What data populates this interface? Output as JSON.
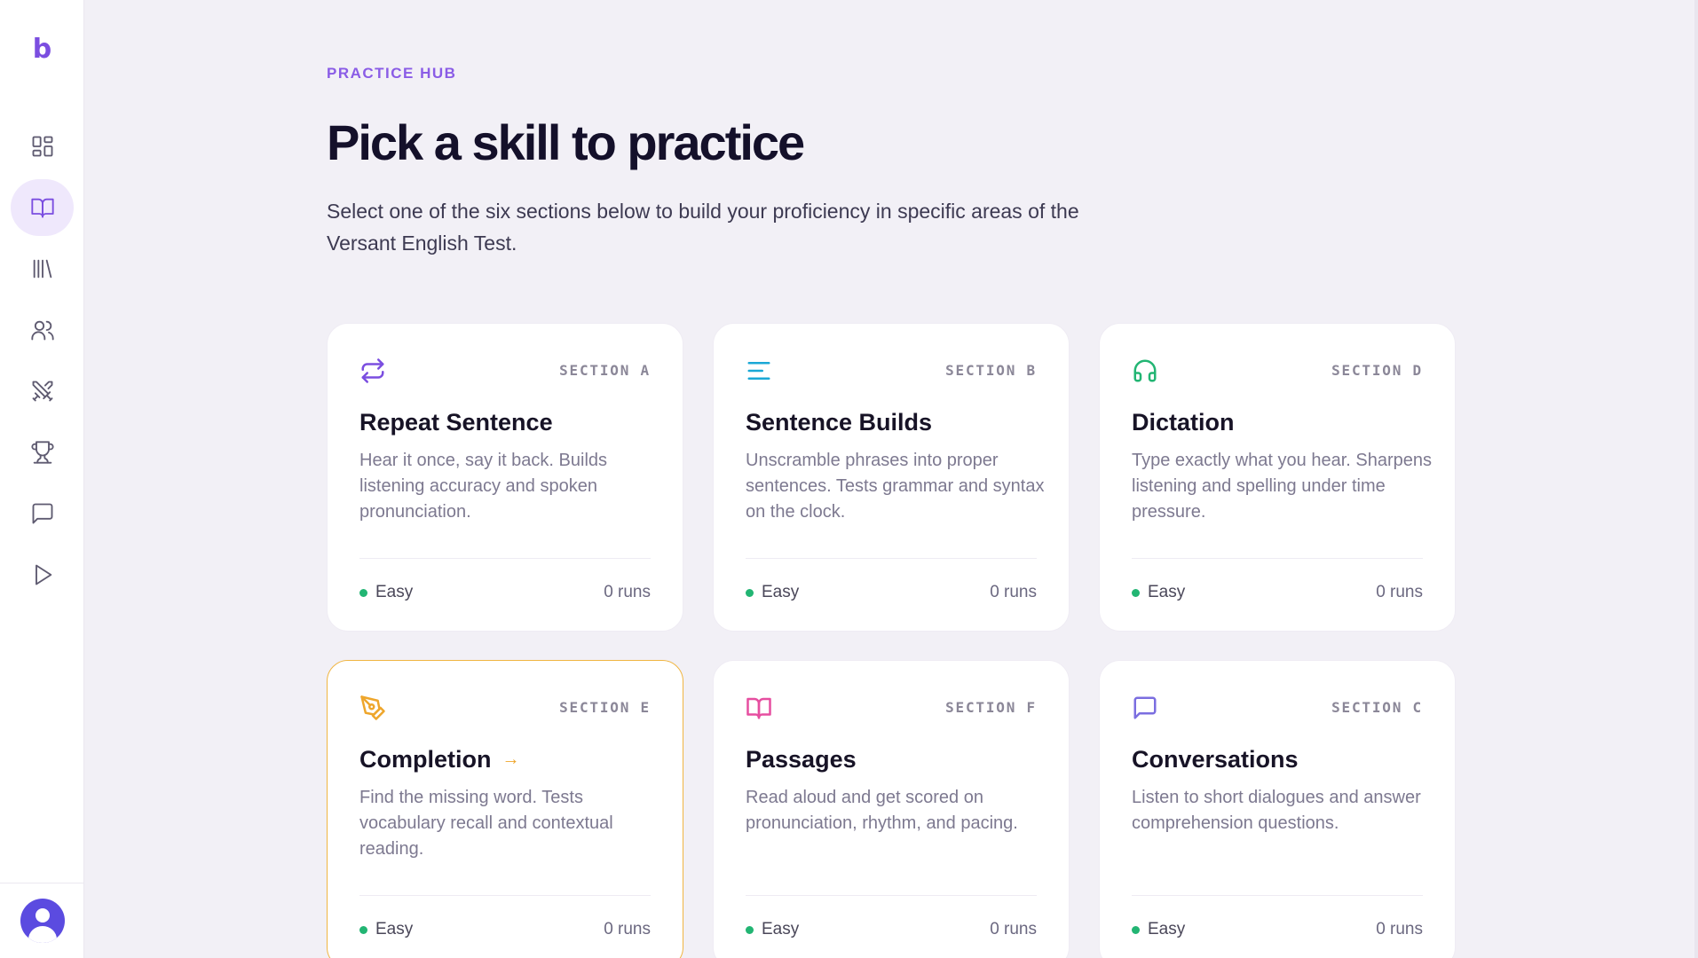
{
  "app": {
    "logo": "b"
  },
  "header": {
    "eyebrow": "PRACTICE HUB",
    "title": "Pick a skill to practice",
    "subtitle": "Select one of the six sections below to build your proficiency in specific areas of the Versant English Test."
  },
  "sidebar": {
    "items": [
      {
        "icon": "dashboard-icon"
      },
      {
        "icon": "open-book-icon",
        "active": true
      },
      {
        "icon": "library-icon"
      },
      {
        "icon": "users-icon"
      },
      {
        "icon": "swords-icon"
      },
      {
        "icon": "trophy-icon"
      },
      {
        "icon": "chat-icon"
      },
      {
        "icon": "play-icon"
      }
    ]
  },
  "cards": [
    {
      "section": "SECTION A",
      "name": "Repeat Sentence",
      "desc": "Hear it once, say it back. Builds listening accuracy and spoken pronunciation.",
      "level": "Easy",
      "runs": "0 runs",
      "icon": "repeat-icon",
      "color": "#7b4ee0"
    },
    {
      "section": "SECTION B",
      "name": "Sentence Builds",
      "desc": "Unscramble phrases into proper sentences. Tests grammar and syntax on the clock.",
      "level": "Easy",
      "runs": "0 runs",
      "icon": "align-left-icon",
      "color": "#1aa8d6"
    },
    {
      "section": "SECTION D",
      "name": "Dictation",
      "desc": "Type exactly what you hear. Sharpens listening and spelling under time pressure.",
      "level": "Easy",
      "runs": "0 runs",
      "icon": "headphones-icon",
      "color": "#22b573"
    },
    {
      "section": "SECTION E",
      "name": "Completion",
      "desc": "Find the missing word. Tests vocabulary recall and contextual reading.",
      "level": "Easy",
      "runs": "0 runs",
      "icon": "pen-tool-icon",
      "color": "#eea62c",
      "arrow": "→"
    },
    {
      "section": "SECTION F",
      "name": "Passages",
      "desc": "Read aloud and get scored on pronunciation, rhythm, and pacing.",
      "level": "Easy",
      "runs": "0 runs",
      "icon": "open-book-icon",
      "color": "#e64ea0"
    },
    {
      "section": "SECTION C",
      "name": "Conversations",
      "desc": "Listen to short dialogues and answer comprehension questions.",
      "level": "Easy",
      "runs": "0 runs",
      "icon": "chat-icon",
      "color": "#7b6ee0"
    }
  ]
}
